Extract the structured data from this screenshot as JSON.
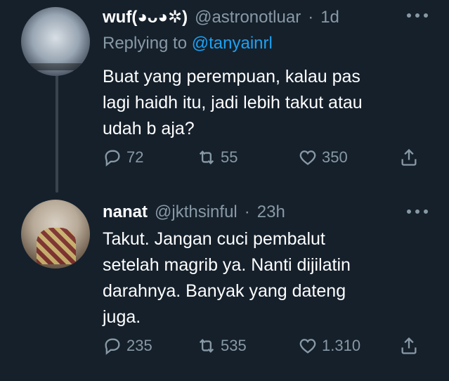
{
  "tweets": [
    {
      "name": "wuf(◕ᴗ◕✲)",
      "handle": "@astronotluar",
      "separator": "·",
      "time": "1d",
      "replying_prefix": "Replying to",
      "replying_to": "@tanyainrl",
      "text": "Buat yang perempuan, kalau pas\nlagi haidh itu, jadi lebih takut atau\nudah b aja?",
      "replies": "72",
      "retweets": "55",
      "likes": "350"
    },
    {
      "name": "nanat",
      "handle": "@jkthsinful",
      "separator": "·",
      "time": "23h",
      "text": "Takut. Jangan cuci pembalut\nsetelah magrib ya. Nanti dijilatin\ndarahnya. Banyak yang dateng\njuga.",
      "replies": "235",
      "retweets": "535",
      "likes": "1.310"
    }
  ],
  "colors": {
    "background": "#15202b",
    "text_secondary": "#8899a6",
    "link": "#1da1f2",
    "thread_line": "#38444d"
  },
  "icons": [
    "reply-icon",
    "retweet-icon",
    "like-icon",
    "share-icon",
    "more-icon"
  ]
}
